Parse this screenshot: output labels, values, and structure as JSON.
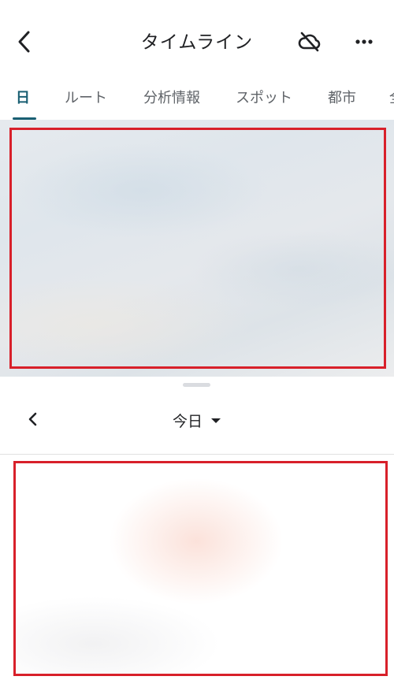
{
  "header": {
    "title": "タイムライン",
    "back_icon": "back-arrow-icon",
    "cloud_icon": "cloud-off-icon",
    "more_icon": "more-horiz-icon"
  },
  "tabs": [
    {
      "label": "日",
      "active": true
    },
    {
      "label": "ルート",
      "active": false
    },
    {
      "label": "分析情報",
      "active": false
    },
    {
      "label": "スポット",
      "active": false
    },
    {
      "label": "都市",
      "active": false
    },
    {
      "label": "全",
      "active": false
    }
  ],
  "date_nav": {
    "label": "今日",
    "prev_icon": "chevron-left-icon",
    "dropdown_icon": "dropdown-caret-icon"
  },
  "colors": {
    "accent": "#1a5f73",
    "redaction_border": "#d8202a"
  }
}
